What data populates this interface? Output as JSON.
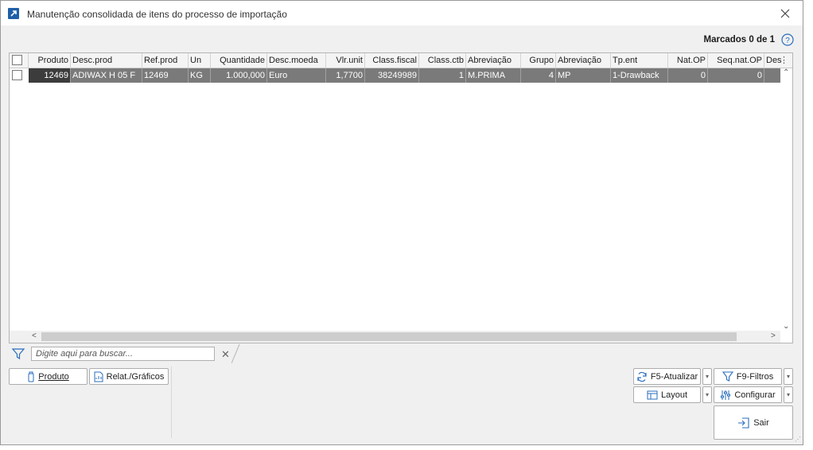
{
  "window": {
    "title": "Manutenção consolidada de itens do processo de importação"
  },
  "header": {
    "marked_label": "Marcados 0 de 1"
  },
  "columns": [
    "Produto",
    "Desc.prod",
    "Ref.prod",
    "Un",
    "Quantidade",
    "Desc.moeda",
    "Vlr.unit",
    "Class.fiscal",
    "Class.ctb",
    "Abreviação",
    "Grupo",
    "Abreviação",
    "Tp.ent",
    "Nat.OP",
    "Seq.nat.OP",
    "Des"
  ],
  "rows": [
    {
      "produto": "12469",
      "desc_prod": "ADIWAX H 05 F",
      "ref_prod": "12469",
      "un": "KG",
      "quantidade": "1.000,000",
      "desc_moeda": "Euro",
      "vlr_unit": "1,7700",
      "class_fiscal": "38249989",
      "class_ctb": "1",
      "abreviacao": "M.PRIMA",
      "grupo": "4",
      "abreviacao2": "MP",
      "tp_ent": "1-Drawback",
      "nat_op": "0",
      "seq_nat_op": "0"
    }
  ],
  "search": {
    "placeholder": "Digite aqui para buscar..."
  },
  "buttons": {
    "produto": "Produto",
    "relat": "Relat./Gráficos",
    "atualizar": "F5-Atualizar",
    "filtros": "F9-Filtros",
    "layout": "Layout",
    "configurar": "Configurar",
    "sair": "Sair"
  }
}
